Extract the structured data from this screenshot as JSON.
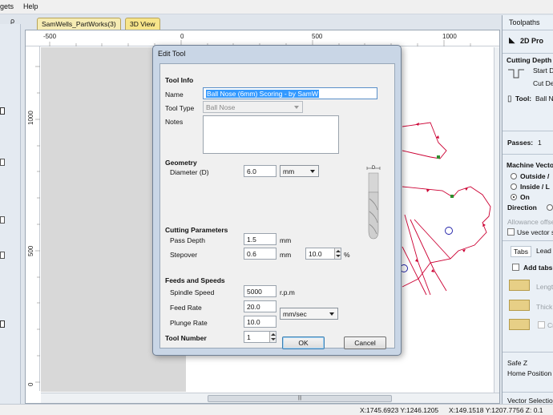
{
  "menu": {
    "gadgets": "gets",
    "help": "Help",
    "pin": "ρ"
  },
  "doc_tabs": [
    {
      "label": "SamWells_PartWorks(3)"
    },
    {
      "label": "3D View"
    }
  ],
  "ruler": {
    "h": [
      "-500",
      "0",
      "500",
      "1000"
    ],
    "v": [
      "1000",
      "500",
      "0"
    ]
  },
  "dialog": {
    "title": "Edit Tool",
    "tool_info": {
      "header": "Tool Info",
      "name_label": "Name",
      "name_value": "Ball Nose (6mm) Scoring - by SamW",
      "type_label": "Tool Type",
      "type_value": "Ball Nose",
      "notes_label": "Notes",
      "notes_value": ""
    },
    "geometry": {
      "header": "Geometry",
      "diameter_label": "Diameter (D)",
      "diameter_value": "6.0",
      "units_value": "mm",
      "diagram_label": "D"
    },
    "cutting": {
      "header": "Cutting Parameters",
      "pass_depth_label": "Pass Depth",
      "pass_depth_value": "1.5",
      "pass_depth_unit": "mm",
      "stepover_label": "Stepover",
      "stepover_value": "0.6",
      "stepover_unit": "mm",
      "stepover_pct_value": "10.0",
      "pct_symbol": "%"
    },
    "feeds": {
      "header": "Feeds and Speeds",
      "spindle_label": "Spindle Speed",
      "spindle_value": "5000",
      "spindle_unit": "r.p.m",
      "feed_label": "Feed Rate",
      "feed_value": "20.0",
      "plunge_label": "Plunge Rate",
      "plunge_value": "10.0",
      "rate_units_value": "mm/sec"
    },
    "tool_number": {
      "label": "Tool Number",
      "value": "1"
    },
    "ok_label": "OK",
    "cancel_label": "Cancel"
  },
  "right_panel": {
    "title": "Toolpaths",
    "subtitle": "2D Pro",
    "cutting_depth": "Cutting Depth",
    "start_d": "Start D",
    "cut_de": "Cut De",
    "tool_label": "Tool:",
    "tool_value": "Ball No",
    "passes_label": "Passes:",
    "passes_value": "1",
    "machine_vector": "Machine Vecto",
    "outside": "Outside /",
    "inside": "Inside / L",
    "on": "On",
    "direction": "Direction",
    "allowance": "Allowance offset",
    "use_vector": "Use vector st",
    "tabs_tab": "Tabs",
    "lead_tab": "Lead",
    "add_tabs": "Add tabs",
    "length": "Length",
    "thickness": "Thick",
    "cr": "Cr",
    "safe_z": "Safe Z",
    "home_position": "Home Position",
    "vector_selection": "Vector Selection"
  },
  "status": {
    "coords1": "X:1745.6923 Y:1246.1205",
    "coords2": "X:149.1518 Y:1207.7756 Z: 0.1"
  },
  "colors": {
    "accent": "#3399ff",
    "vector": "#cc0033",
    "tab_yellow": "#f7e58a",
    "node_green": "#2f8f2f",
    "circle_blue": "#1a1aa6"
  }
}
